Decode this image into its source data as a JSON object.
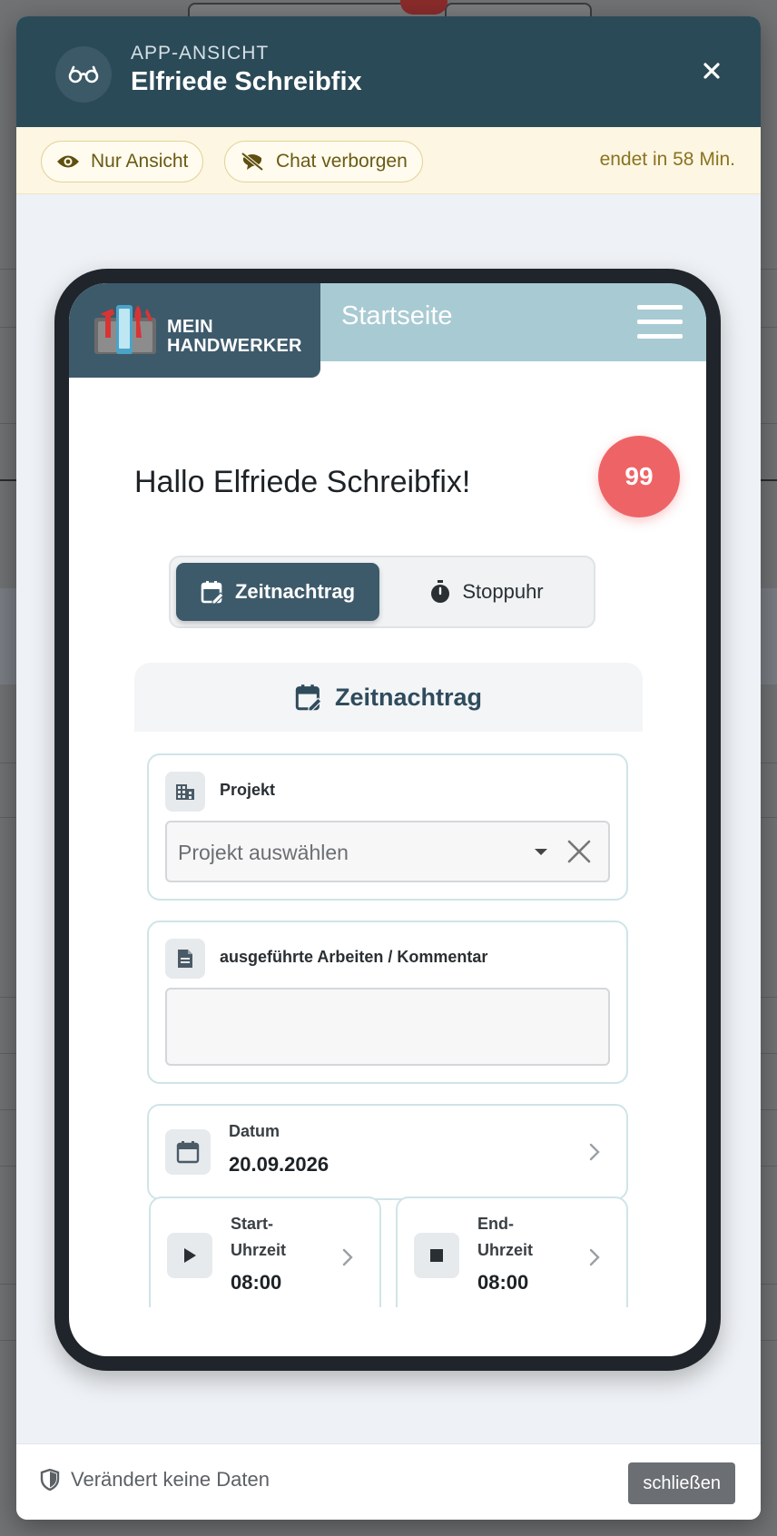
{
  "modal": {
    "eyebrow": "APP-ANSICHT",
    "title": "Elfriede Schreibfix",
    "info_bar": {
      "view_only": "Nur Ansicht",
      "chat_hidden": "Chat verborgen",
      "ends_in": "endet in 58 Min."
    },
    "footer": {
      "note": "Verändert keine Daten",
      "close_label": "schließen"
    }
  },
  "app": {
    "brand_line1": "MEIN",
    "brand_line2": "HANDWERKER",
    "page_title": "Startseite",
    "greeting": "Hallo Elfriede Schreibfix!",
    "notification_count": "99",
    "segments": {
      "active": "Zeitnachtrag",
      "inactive": "Stoppuhr"
    },
    "form": {
      "title": "Zeitnachtrag",
      "project_label": "Projekt",
      "project_placeholder": "Projekt auswählen",
      "comment_label": "ausgeführte Arbeiten / Kommentar",
      "date_label": "Datum",
      "date_value": "20.09.2026",
      "start_label_1": "Start-",
      "start_label_2": "Uhrzeit",
      "start_value": "08:00",
      "end_label_1": "End-",
      "end_label_2": "Uhrzeit",
      "end_value": "08:00"
    }
  },
  "colors": {
    "header": "#2b4a58",
    "brand": "#3d5a6b",
    "app_bar": "#a8cad3",
    "badge": "#ee6466",
    "info_bar": "#fdf6e3"
  }
}
